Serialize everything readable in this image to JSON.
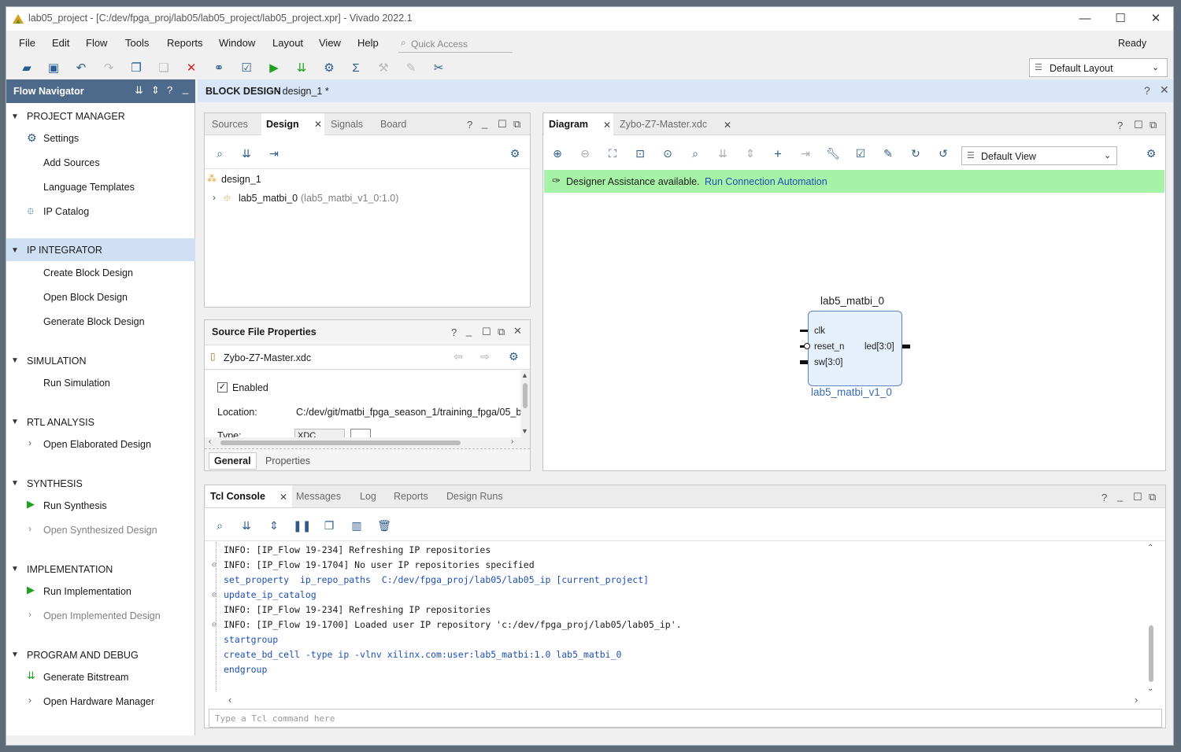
{
  "window": {
    "title": "lab05_project - [C:/dev/fpga_proj/lab05/lab05_project/lab05_project.xpr] - Vivado 2022.1",
    "status": "Ready",
    "minimize": "—",
    "maximize": "☐",
    "close": "✕"
  },
  "menu": [
    "File",
    "Edit",
    "Flow",
    "Tools",
    "Reports",
    "Window",
    "Layout",
    "View",
    "Help"
  ],
  "quick_access": {
    "placeholder": "Quick Access"
  },
  "layout_select": {
    "value": "Default Layout"
  },
  "toolbar_icons": [
    "open-icon",
    "save-icon",
    "undo-icon",
    "redo-icon",
    "copy-icon",
    "paste-icon",
    "delete-icon",
    "find-icon",
    "check-icon",
    "run-icon",
    "bitstream-icon",
    "settings-icon",
    "sum-icon",
    "cancel-icon",
    "edit-icon",
    "close-icon"
  ],
  "flow_nav": {
    "title": "Flow Navigator",
    "sections": [
      {
        "title": "PROJECT MANAGER",
        "items": [
          "Settings",
          "Add Sources",
          "Language Templates",
          "IP Catalog"
        ]
      },
      {
        "title": "IP INTEGRATOR",
        "items": [
          "Create Block Design",
          "Open Block Design",
          "Generate Block Design"
        ]
      },
      {
        "title": "SIMULATION",
        "items": [
          "Run Simulation"
        ]
      },
      {
        "title": "RTL ANALYSIS",
        "items": [
          "Open Elaborated Design"
        ]
      },
      {
        "title": "SYNTHESIS",
        "items": [
          "Run Synthesis",
          "Open Synthesized Design"
        ]
      },
      {
        "title": "IMPLEMENTATION",
        "items": [
          "Run Implementation",
          "Open Implemented Design"
        ]
      },
      {
        "title": "PROGRAM AND DEBUG",
        "items": [
          "Generate Bitstream",
          "Open Hardware Manager"
        ]
      }
    ]
  },
  "block_design": {
    "label": "BLOCK DESIGN",
    "name": "- design_1 *"
  },
  "sources_panel": {
    "tabs": [
      "Sources",
      "Design",
      "Signals",
      "Board"
    ],
    "root": "design_1",
    "child": "lab5_matbi_0",
    "child_ip": "(lab5_matbi_v1_0:1.0)"
  },
  "source_props": {
    "title": "Source File Properties",
    "file": "Zybo-Z7-Master.xdc",
    "enabled_label": "Enabled",
    "location_label": "Location:",
    "location_value": "C:/dev/git/matbi_fpga_season_1/training_fpga/05_b",
    "type_label": "Type:",
    "type_value": "XDC",
    "tabs": [
      "General",
      "Properties"
    ]
  },
  "diagram": {
    "tabs": [
      "Diagram",
      "Zybo-Z7-Master.xdc"
    ],
    "view_select": "Default View",
    "assist_text": "Designer Assistance available.",
    "assist_link": "Run Connection Automation",
    "block": {
      "title": "lab5_matbi_0",
      "subtitle": "lab5_matbi_v1_0",
      "ports_in": [
        "clk",
        "reset_n",
        "sw[3:0]"
      ],
      "ports_out": [
        "led[3:0]"
      ]
    }
  },
  "console": {
    "tabs": [
      "Tcl Console",
      "Messages",
      "Log",
      "Reports",
      "Design Runs"
    ],
    "lines": [
      {
        "text": "INFO: [IP_Flow 19-234] Refreshing IP repositories",
        "kind": "info"
      },
      {
        "text": "INFO: [IP_Flow 19-1704] No user IP repositories specified",
        "kind": "info"
      },
      {
        "text": "set_property  ip_repo_paths  C:/dev/fpga_proj/lab05/lab05_ip [current_project]",
        "kind": "cmd"
      },
      {
        "text": "update_ip_catalog",
        "kind": "cmd"
      },
      {
        "text": "INFO: [IP_Flow 19-234] Refreshing IP repositories",
        "kind": "info"
      },
      {
        "text": "INFO: [IP_Flow 19-1700] Loaded user IP repository 'c:/dev/fpga_proj/lab05/lab05_ip'.",
        "kind": "info"
      },
      {
        "text": "startgroup",
        "kind": "cmd"
      },
      {
        "text": "create_bd_cell -type ip -vlnv xilinx.com:user:lab5_matbi:1.0 lab5_matbi_0",
        "kind": "cmd"
      },
      {
        "text": "endgroup",
        "kind": "cmd"
      }
    ],
    "input_placeholder": "Type a Tcl command here"
  },
  "colors": {
    "accent": "#1e4fb5",
    "assist_bg": "#a6f2a6",
    "header_bg": "#d9e6f7",
    "selected": "#cfe0f5"
  }
}
